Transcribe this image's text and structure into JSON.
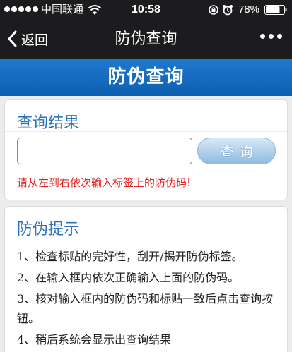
{
  "status_bar": {
    "carrier": "中国联通",
    "time": "10:58",
    "battery": "78%",
    "battery_level": 0.78
  },
  "nav": {
    "back_label": "返回",
    "title": "防伪查询"
  },
  "page_header": {
    "title": "防伪查询"
  },
  "result_card": {
    "title": "查询结果",
    "input_value": "",
    "button_label": "查询",
    "hint": "请从左到右依次输入标签上的防伪码!"
  },
  "tips_card": {
    "title": "防伪提示",
    "items": [
      "1、检查标贴的完好性，刮开/揭开防伪标签。",
      "2、在输入框内依次正确输入上面的防伪码。",
      "3、核对输入框内的防伪码和标贴一致后点击查询按钮。",
      "4、稍后系统会显示出查询结果"
    ]
  },
  "colors": {
    "header_blue": "#1f7ad0",
    "title_blue": "#2f73b8",
    "hint_red": "#e02020"
  }
}
